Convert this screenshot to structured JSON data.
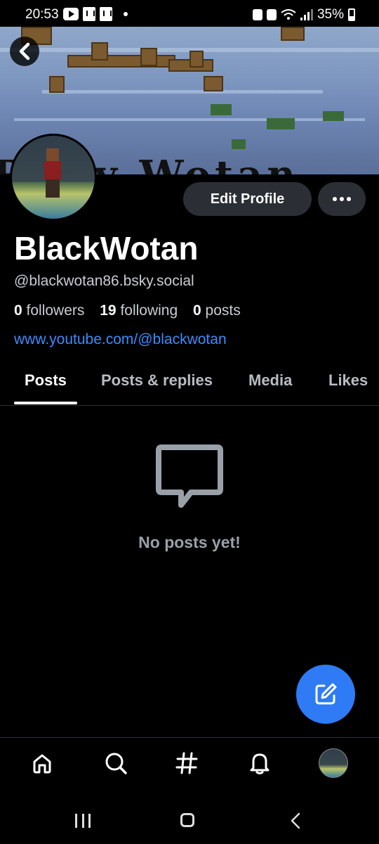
{
  "status_bar": {
    "time": "20:53",
    "battery": "35%"
  },
  "banner": {
    "text": "Ruby Wotan"
  },
  "profile": {
    "edit_label": "Edit Profile",
    "display_name": "BlackWotan",
    "handle": "@blackwotan86.bsky.social",
    "followers_count": "0",
    "followers_label": "followers",
    "following_count": "19",
    "following_label": "following",
    "posts_count": "0",
    "posts_label": "posts",
    "link": "www.youtube.com/@blackwotan"
  },
  "tabs": [
    {
      "label": "Posts",
      "active": true
    },
    {
      "label": "Posts & replies",
      "active": false
    },
    {
      "label": "Media",
      "active": false
    },
    {
      "label": "Likes",
      "active": false
    }
  ],
  "empty_state": {
    "text": "No posts yet!"
  },
  "colors": {
    "accent": "#2f7bf5",
    "link": "#3b8cff",
    "background": "#000000",
    "button_bg": "#2b2f35"
  },
  "icons": {
    "back": "chevron-left-icon",
    "more": "ellipsis-icon",
    "empty": "message-bubble-icon",
    "compose": "compose-icon",
    "nav": [
      "home-icon",
      "search-icon",
      "hashtag-icon",
      "bell-icon",
      "avatar"
    ]
  }
}
